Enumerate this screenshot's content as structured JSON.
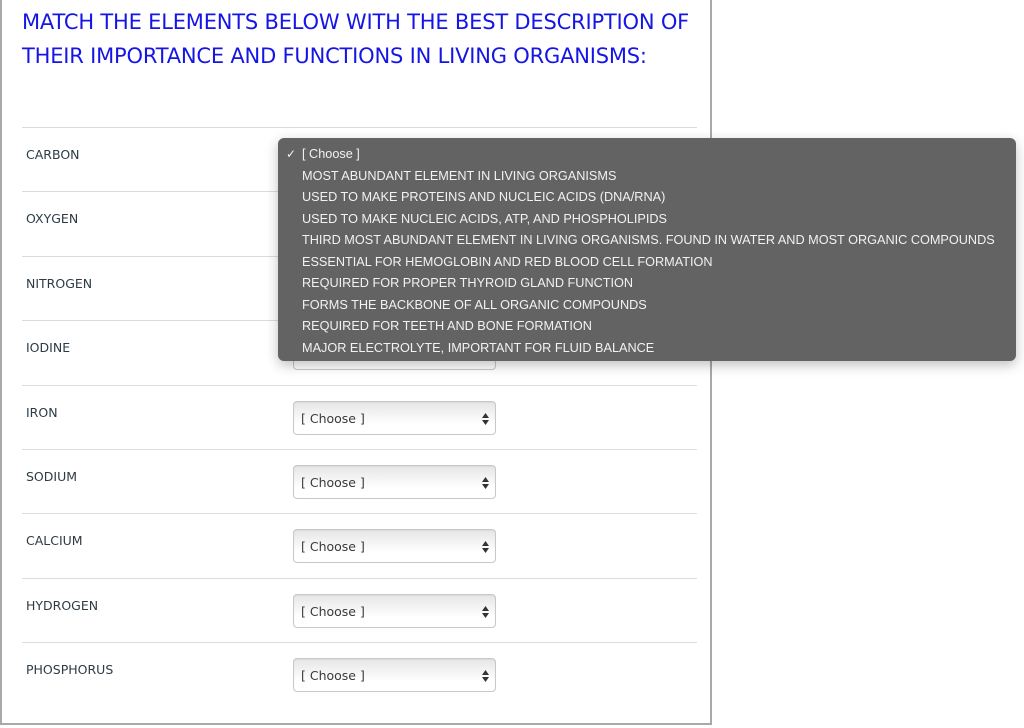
{
  "question": {
    "title": "MATCH THE ELEMENTS BELOW WITH THE BEST DESCRIPTION OF THEIR IMPORTANCE AND FUNCTIONS IN LIVING ORGANISMS:",
    "title_color": "#1515e6"
  },
  "rows": [
    {
      "label": "CARBON",
      "selected": "[ Choose ]"
    },
    {
      "label": "OXYGEN",
      "selected": "[ Choose ]"
    },
    {
      "label": "NITROGEN",
      "selected": "[ Choose ]"
    },
    {
      "label": "IODINE",
      "selected": "[ Choose ]"
    },
    {
      "label": "IRON",
      "selected": "[ Choose ]"
    },
    {
      "label": "SODIUM",
      "selected": "[ Choose ]"
    },
    {
      "label": "CALCIUM",
      "selected": "[ Choose ]"
    },
    {
      "label": "HYDROGEN",
      "selected": "[ Choose ]"
    },
    {
      "label": "PHOSPHORUS",
      "selected": "[ Choose ]"
    }
  ],
  "dropdown": {
    "open_for": "CARBON",
    "background": "#636363",
    "check_icon": "✓",
    "options": [
      {
        "label": "[ Choose ]",
        "checked": true
      },
      {
        "label": "MOST ABUNDANT ELEMENT IN LIVING ORGANISMS",
        "checked": false
      },
      {
        "label": "USED TO MAKE PROTEINS AND NUCLEIC ACIDS (DNA/RNA)",
        "checked": false
      },
      {
        "label": "USED TO MAKE NUCLEIC ACIDS, ATP, AND PHOSPHOLIPIDS",
        "checked": false
      },
      {
        "label": "THIRD MOST ABUNDANT ELEMENT IN LIVING ORGANISMS. FOUND IN WATER AND MOST ORGANIC COMPOUNDS",
        "checked": false
      },
      {
        "label": "ESSENTIAL FOR HEMOGLOBIN AND RED BLOOD CELL FORMATION",
        "checked": false
      },
      {
        "label": "REQUIRED FOR PROPER THYROID GLAND FUNCTION",
        "checked": false
      },
      {
        "label": "FORMS THE BACKBONE OF ALL ORGANIC COMPOUNDS",
        "checked": false
      },
      {
        "label": "REQUIRED FOR TEETH AND BONE FORMATION",
        "checked": false
      },
      {
        "label": "MAJOR ELECTROLYTE, IMPORTANT FOR FLUID BALANCE",
        "checked": false
      }
    ]
  }
}
